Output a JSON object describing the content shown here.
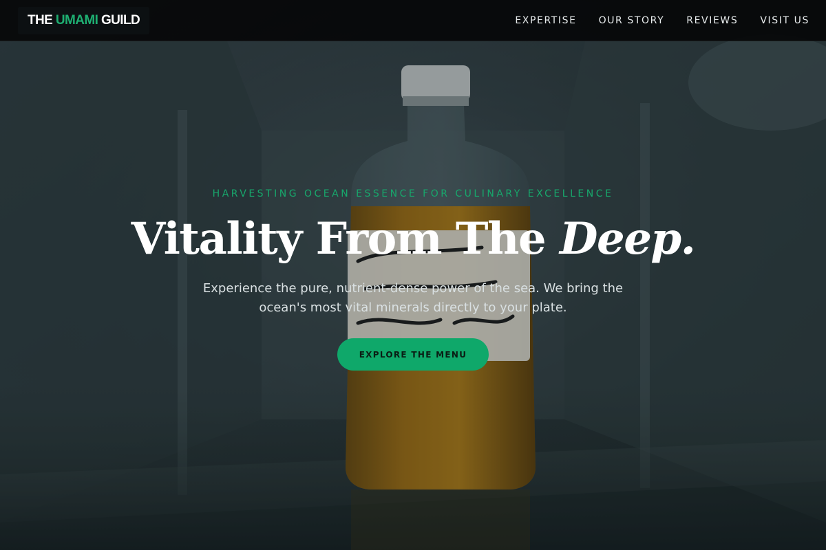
{
  "brand": {
    "prefix": "THE",
    "accent": "UMAMI",
    "suffix": "GUILD",
    "accent_color": "#1eaf72"
  },
  "nav": {
    "links": [
      {
        "label": "EXPERTISE"
      },
      {
        "label": "OUR STORY"
      },
      {
        "label": "REVIEWS"
      },
      {
        "label": "VISIT US"
      }
    ]
  },
  "hero": {
    "eyebrow": "HARVESTING OCEAN ESSENCE FOR CULINARY EXCELLENCE",
    "headline_main": "Vitality From The",
    "headline_emphasis": "Deep.",
    "subtitle": "Experience the pure, nutrient-dense power of the sea. We bring the ocean's most vital minerals directly to your plate.",
    "cta_label": "EXPLORE THE MENU",
    "background_image": "glass bottle of amber liquid with handwritten label inside a refrigerator"
  },
  "colors": {
    "nav_background": "#060809",
    "eyebrow": "#17a86c",
    "cta_background": "#0fa86a",
    "headline": "#ffffff"
  }
}
